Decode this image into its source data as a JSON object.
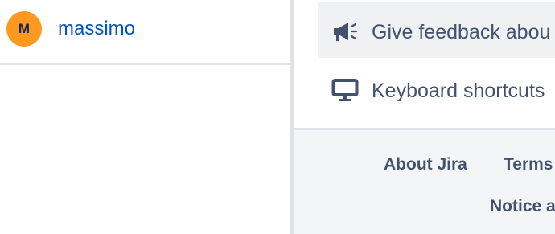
{
  "user": {
    "avatar_initial": "M",
    "name": "massimo"
  },
  "menu": {
    "items": [
      {
        "label": "Give feedback abou",
        "icon": "megaphone-icon"
      },
      {
        "label": "Keyboard shortcuts",
        "icon": "monitor-icon"
      }
    ]
  },
  "footer": {
    "about": "About Jira",
    "terms": "Terms",
    "notice": "Notice a"
  },
  "colors": {
    "accent": "#0052cc",
    "avatar": "#ff991f",
    "text": "#42526e",
    "hover_bg": "#f0f1f3",
    "footer_bg": "#f4f5f7",
    "border": "#dfe1e6"
  }
}
